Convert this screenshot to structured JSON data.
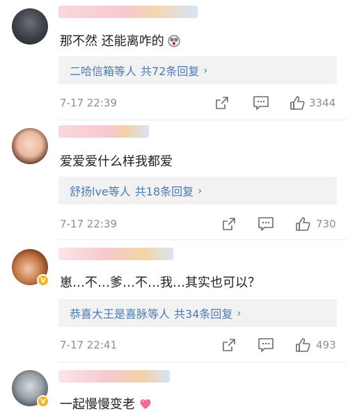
{
  "comments": [
    {
      "text": "那不然 还能离咋的",
      "reply_summary": "二哈信箱等人",
      "reply_count": "共72条回复",
      "time": "7-17 22:39",
      "likes": "3344"
    },
    {
      "text": "爱爱爱什么样我都爱",
      "reply_summary": "舒扬lve等人",
      "reply_count": "共18条回复",
      "time": "7-17 22:39",
      "likes": "730"
    },
    {
      "text": "崽…不…爹…不…我…其实也可以？",
      "reply_summary": "恭喜大王是喜脉等人",
      "reply_count": "共34条回复",
      "time": "7-17 22:41",
      "likes": "493"
    },
    {
      "text": "一起慢慢变老"
    }
  ],
  "colors": {
    "link": "#4a7bb5",
    "meta": "#8e8e8e",
    "reply_bg": "#f2f2f2",
    "verified_badge": "#f5b31c"
  },
  "icons": {
    "share": "share-icon",
    "comment": "comment-icon",
    "like": "like-icon",
    "emoji_face": "surprised-face-emoji",
    "emoji_heart": "heart-emoji"
  }
}
